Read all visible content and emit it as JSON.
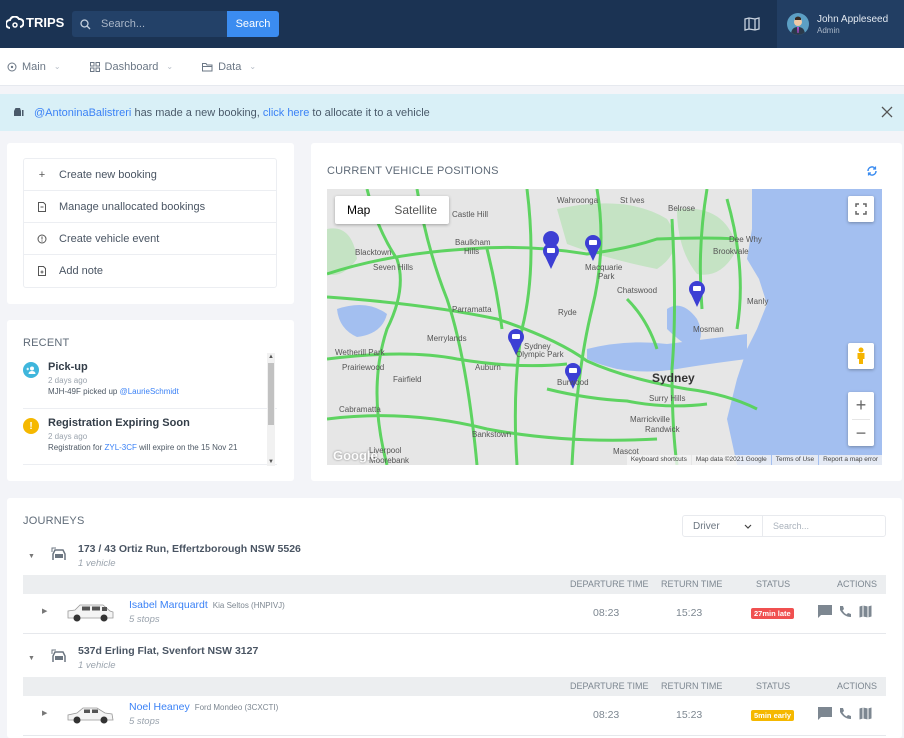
{
  "app": {
    "brand": "TRIPS"
  },
  "topbar": {
    "search_placeholder": "Search...",
    "search_button": "Search",
    "user": {
      "name": "John Appleseed",
      "role": "Admin"
    }
  },
  "nav": {
    "items": [
      {
        "label": "Main",
        "icon": "dashboard-gauge-icon"
      },
      {
        "label": "Dashboard",
        "icon": "grid-icon"
      },
      {
        "label": "Data",
        "icon": "folder-icon"
      }
    ]
  },
  "alert": {
    "user_link": "@AntoninaBalistreri",
    "text1": " has made a new booking, ",
    "action_link": "click here",
    "text2": " to allocate it to a vehicle"
  },
  "quick_actions": [
    {
      "label": "Create new booking",
      "icon": "plus-icon"
    },
    {
      "label": "Manage unallocated bookings",
      "icon": "document-icon"
    },
    {
      "label": "Create vehicle event",
      "icon": "alert-circle-icon"
    },
    {
      "label": "Add note",
      "icon": "note-icon"
    }
  ],
  "recent": {
    "title": "RECENT",
    "items": [
      {
        "title": "Pick-up",
        "time": "2 days ago",
        "desc_prefix": "MJH-49F picked up ",
        "link": "@LaurieSchmidt",
        "desc_suffix": "",
        "color": "#3fb6dc"
      },
      {
        "title": "Registration Expiring Soon",
        "time": "2 days ago",
        "desc_prefix": "Registration for ",
        "link": "ZYL-3CF",
        "desc_suffix": " will expire on the 15 Nov 21",
        "color": "#f5b800"
      }
    ]
  },
  "map": {
    "title": "CURRENT VEHICLE POSITIONS",
    "type_map": "Map",
    "type_satellite": "Satellite",
    "labels": [
      "Wahroonga",
      "St Ives",
      "Belrose",
      "Castle Hill",
      "Dee Why",
      "Brookvale",
      "Blacktown",
      "Baulkham Hills",
      "Seven Hills",
      "Macquarie Park",
      "Chatswood",
      "Manly",
      "Mosman",
      "Parramatta",
      "Ryde",
      "Merrylands",
      "Sydney Olympic Park",
      "Wetherill Park",
      "Prairiewood",
      "Auburn",
      "Fairfield",
      "Burwood",
      "Sydney",
      "Surry Hills",
      "Cabramatta",
      "Marrickville",
      "Randwick",
      "Bankstown",
      "Liverpool",
      "Moorebank",
      "Mascot"
    ],
    "footer": [
      "Keyboard shortcuts",
      "Map data ©2021 Google",
      "Terms of Use",
      "Report a map error"
    ],
    "google": "Google"
  },
  "journeys": {
    "title": "JOURNEYS",
    "filter_select": "Driver",
    "filter_placeholder": "Search...",
    "columns": [
      "DEPARTURE TIME",
      "RETURN TIME",
      "STATUS",
      "ACTIONS"
    ],
    "groups": [
      {
        "address": "173 / 43 Ortiz Run, Effertzborough NSW 5526",
        "count": "1 vehicle",
        "rows": [
          {
            "driver": "Isabel Marquardt",
            "vehicle": "Kia Seltos (HNPIVJ)",
            "stops": "5 stops",
            "departure": "08:23",
            "return": "15:23",
            "status": "27min late",
            "status_color": "#f05050"
          }
        ]
      },
      {
        "address": "537d Erling Flat, Svenfort NSW 3127",
        "count": "1 vehicle",
        "rows": [
          {
            "driver": "Noel Heaney",
            "vehicle": "Ford Mondeo (3CXCTI)",
            "stops": "5 stops",
            "departure": "08:23",
            "return": "15:23",
            "status": "5min early",
            "status_color": "#f5b800"
          }
        ]
      }
    ]
  }
}
